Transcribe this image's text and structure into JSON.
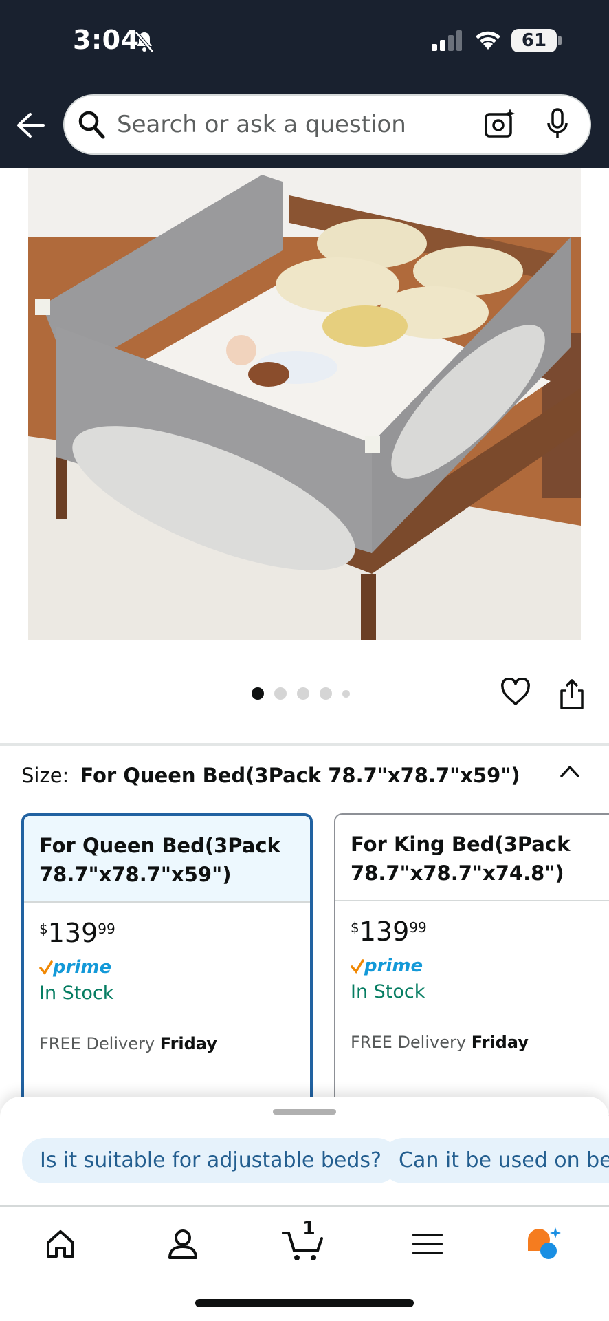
{
  "status_bar": {
    "time": "3:04",
    "battery": "61"
  },
  "search": {
    "placeholder": "Search or ask a question"
  },
  "product_images": {
    "count": 5,
    "active_index": 0
  },
  "size_selector": {
    "prefix": "Size:",
    "selected": "For Queen Bed(3Pack 78.7\"x78.7\"x59\")",
    "options": [
      {
        "line1": "For Queen Bed(3Pack",
        "line2": "78.7\"x78.7\"x59\")",
        "price_symbol": "$",
        "price_whole": "139",
        "price_fraction": "99",
        "prime": "prime",
        "stock": "In Stock",
        "delivery_prefix": "FREE Delivery",
        "delivery_day": "Friday",
        "selected": true
      },
      {
        "line1": "For King Bed(3Pack",
        "line2": "78.7\"x78.7\"x74.8\")",
        "price_symbol": "$",
        "price_whole": "139",
        "price_fraction": "99",
        "prime": "prime",
        "stock": "In Stock",
        "delivery_prefix": "FREE Delivery",
        "delivery_day": "Friday",
        "selected": false
      }
    ]
  },
  "suggestions": [
    "Is it suitable for adjustable beds?",
    "Can it be used on beds"
  ],
  "tabbar": {
    "cart_count": "1",
    "items": [
      "home-icon",
      "account-icon",
      "cart-icon",
      "menu-icon",
      "rufus-icon"
    ]
  },
  "colors": {
    "header_bg": "#19212f",
    "selected_border": "#2162a1",
    "stock_green": "#067d62",
    "prime_blue": "#1399d8",
    "chip_bg": "#e6f2fb"
  }
}
